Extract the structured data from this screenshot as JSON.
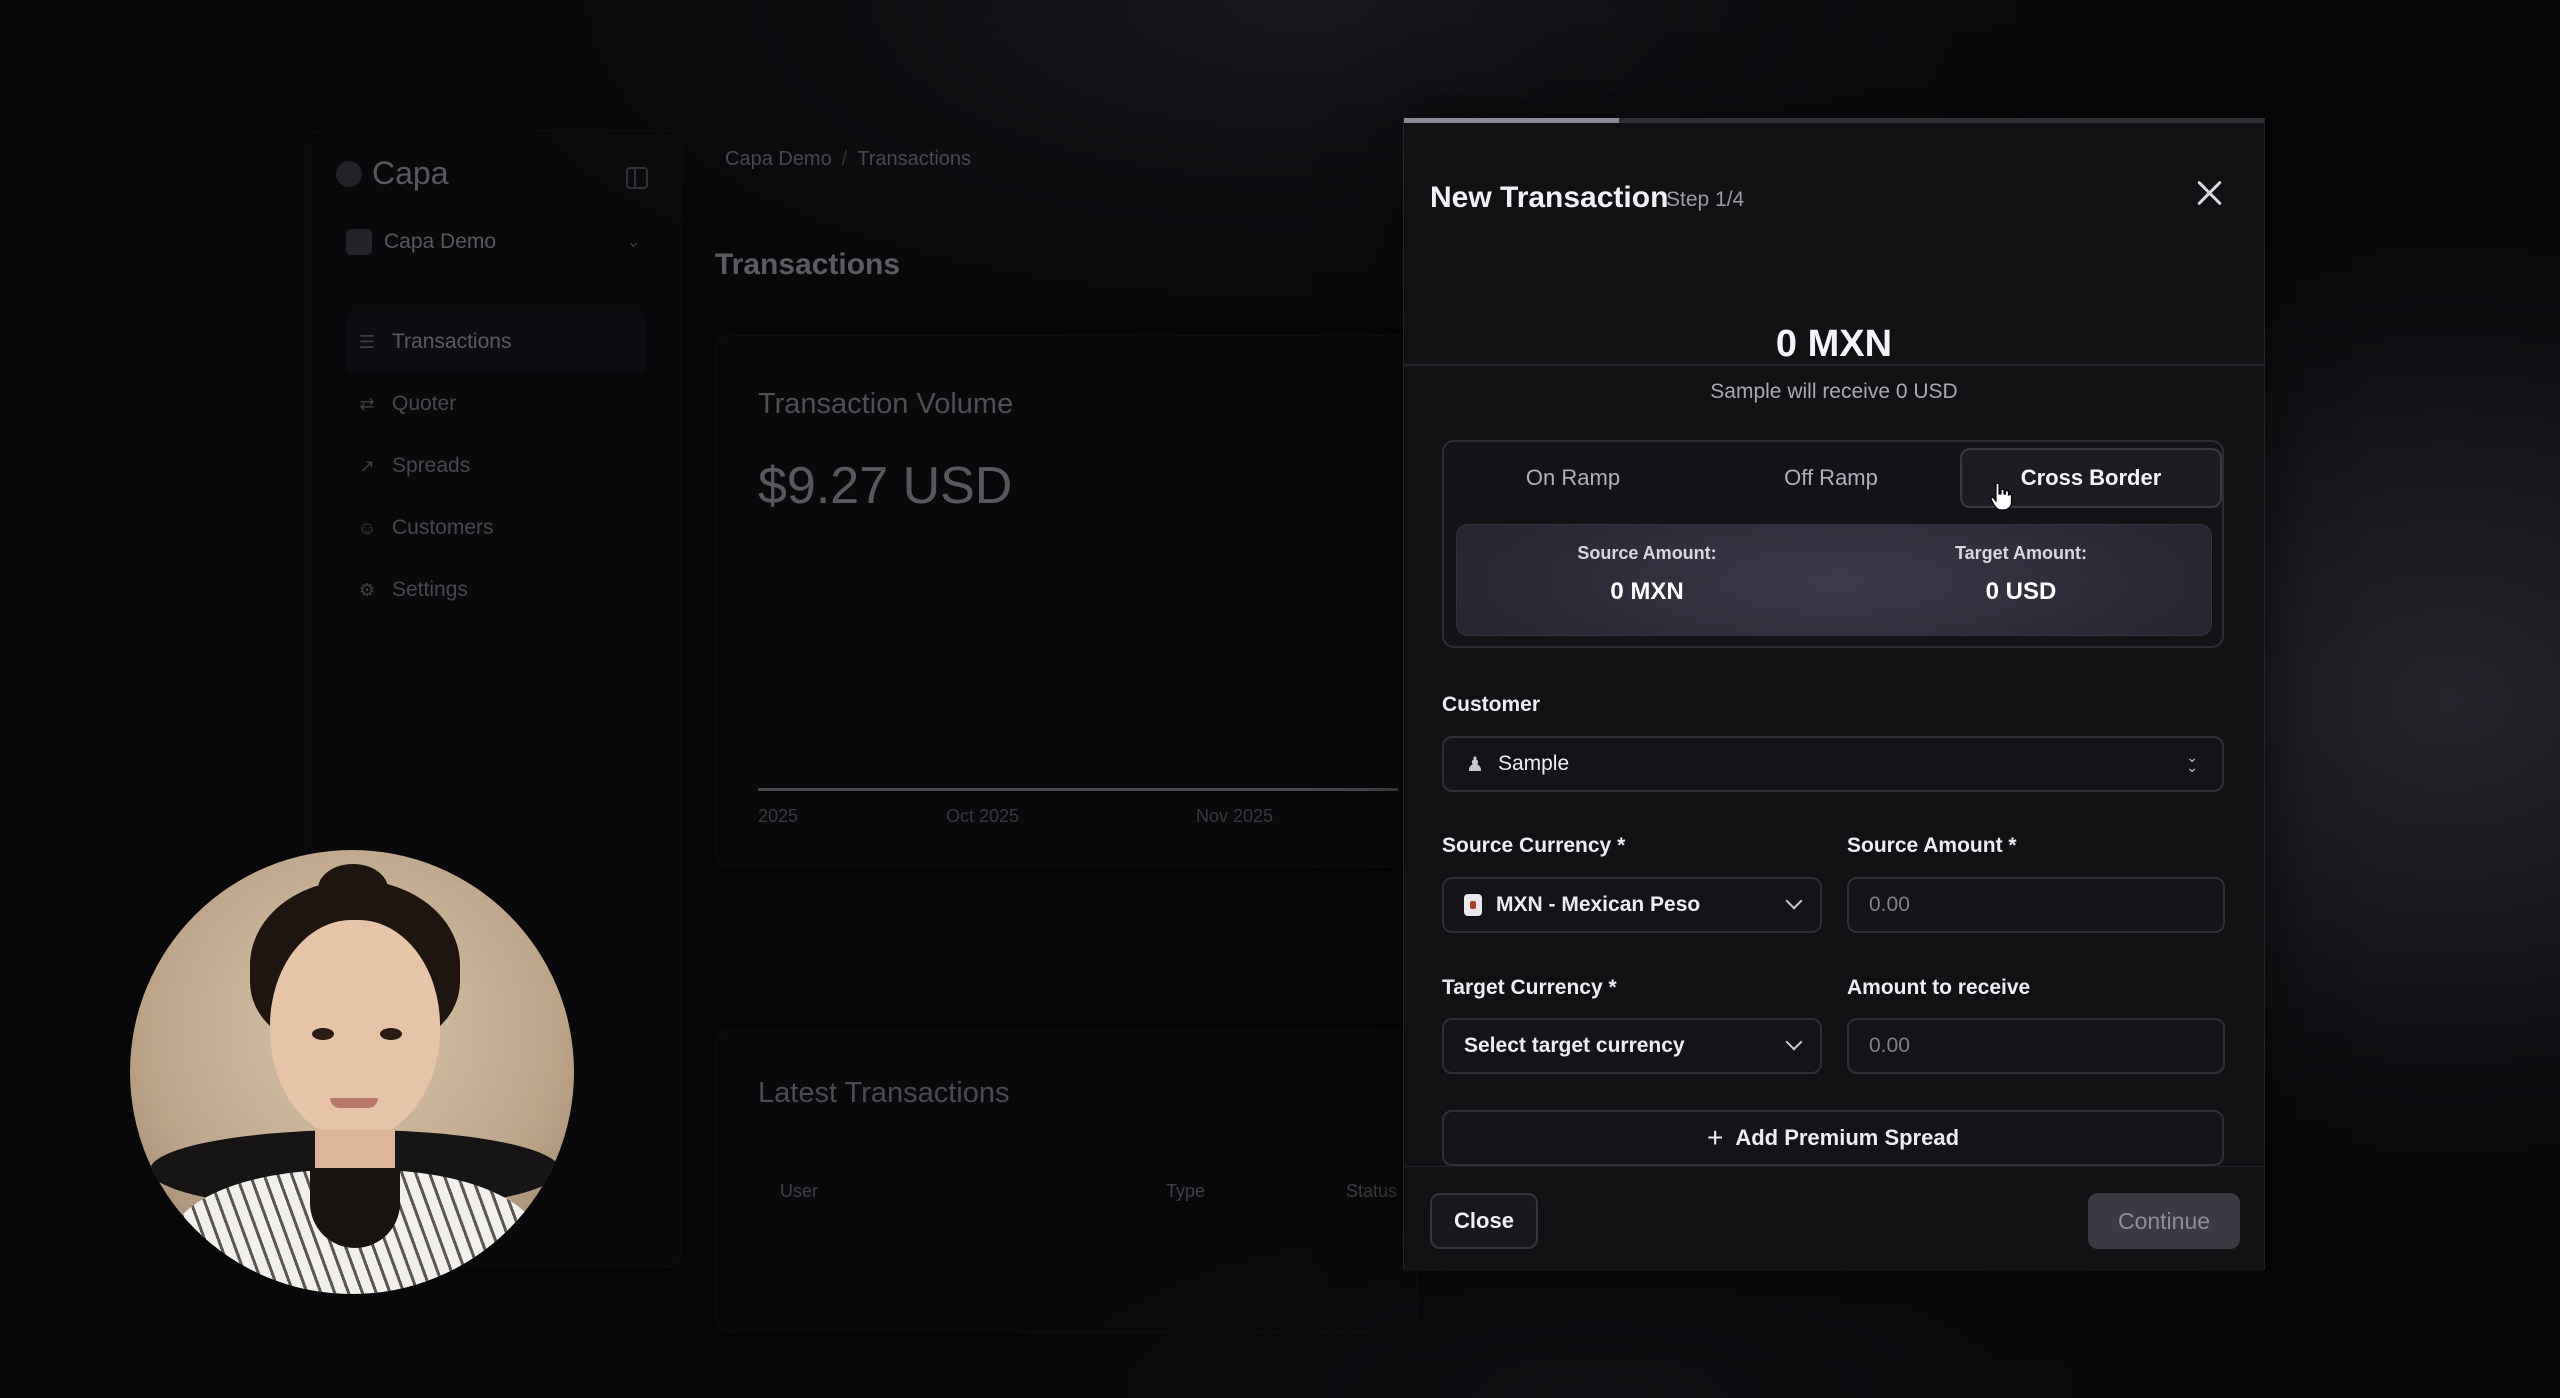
{
  "app": {
    "brand": "Capa",
    "org": "Capa Demo",
    "nav": [
      {
        "label": "Transactions",
        "icon": "list-icon"
      },
      {
        "label": "Quoter",
        "icon": "quoter-icon"
      },
      {
        "label": "Spreads",
        "icon": "spreads-icon"
      },
      {
        "label": "Customers",
        "icon": "user-icon"
      },
      {
        "label": "Settings",
        "icon": "gear-icon"
      }
    ],
    "breadcrumb": {
      "root": "Capa Demo",
      "sep": "/",
      "current": "Transactions"
    },
    "page_title": "Transactions",
    "volume": {
      "title": "Transaction Volume",
      "value": "$9.27 USD",
      "ticks": [
        "2025",
        "Oct 2025",
        "Nov 2025"
      ]
    },
    "latest": {
      "title": "Latest Transactions",
      "columns": [
        "User",
        "Type",
        "Status"
      ]
    }
  },
  "modal": {
    "title": "New Transaction",
    "step": "Step 1/4",
    "progress_fraction": 0.25,
    "summary_amount": "0 MXN",
    "summary_sub": "Sample will receive 0 USD",
    "tabs": [
      "On Ramp",
      "Off Ramp",
      "Cross Border"
    ],
    "active_tab": "Cross Border",
    "source_amount_label": "Source Amount:",
    "source_amount_value": "0 MXN",
    "target_amount_label": "Target Amount:",
    "target_amount_value": "0 USD",
    "customer_label": "Customer",
    "customer_value": "Sample",
    "source_currency_label": "Source Currency *",
    "source_currency_value": "MXN - Mexican Peso",
    "source_amount_field_label": "Source Amount *",
    "source_amount_placeholder": "0.00",
    "target_currency_label": "Target Currency *",
    "target_currency_value": "Select target currency",
    "receive_label": "Amount to receive",
    "receive_placeholder": "0.00",
    "premium_label": "Add Premium Spread",
    "close_label": "Close",
    "continue_label": "Continue"
  },
  "colors": {
    "background": "#070709",
    "modal": "#111114",
    "accent_panel": "#2f2f3c",
    "continue_disabled": "#3a3a42"
  }
}
